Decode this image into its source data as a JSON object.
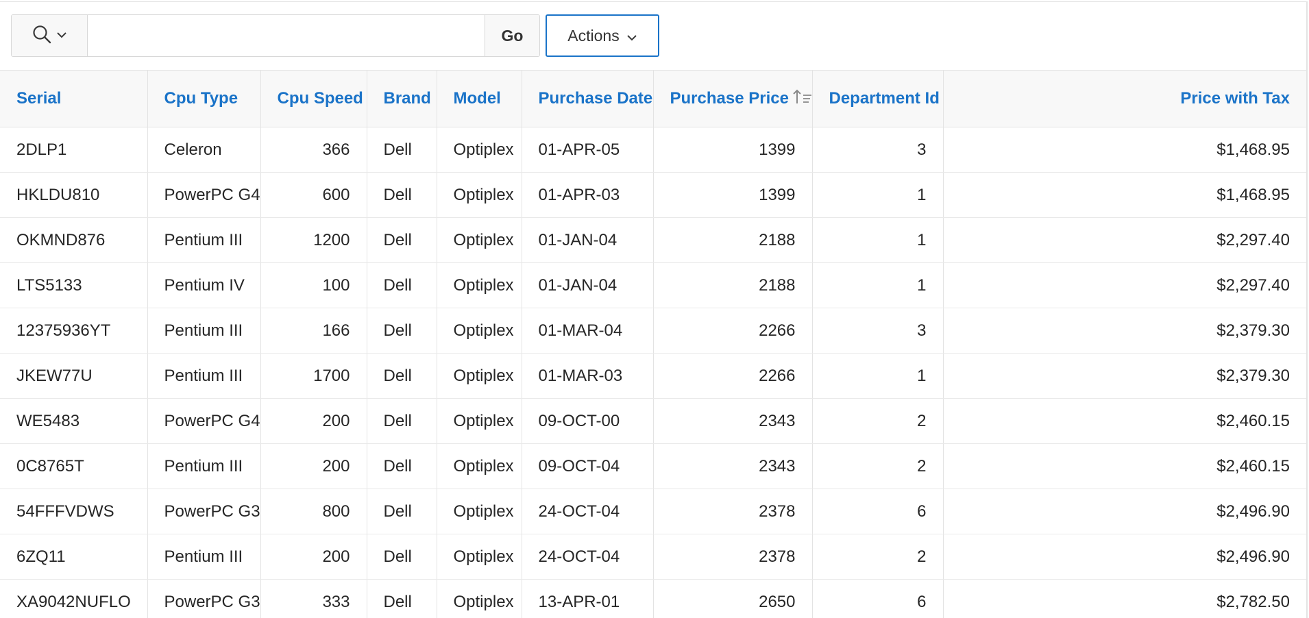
{
  "toolbar": {
    "search_value": "",
    "go_label": "Go",
    "actions_label": "Actions"
  },
  "table": {
    "columns": [
      {
        "label": "Serial",
        "align": "left"
      },
      {
        "label": "Cpu Type",
        "align": "left"
      },
      {
        "label": "Cpu Speed",
        "align": "right"
      },
      {
        "label": "Brand",
        "align": "left"
      },
      {
        "label": "Model",
        "align": "left"
      },
      {
        "label": "Purchase Date",
        "align": "left"
      },
      {
        "label": "Purchase Price",
        "align": "right",
        "sorted": "ascending"
      },
      {
        "label": "Department Id",
        "align": "right"
      },
      {
        "label": "Price with Tax",
        "align": "right"
      }
    ],
    "rows": [
      [
        "2DLP1",
        "Celeron",
        "366",
        "Dell",
        "Optiplex",
        "01-APR-05",
        "1399",
        "3",
        "$1,468.95"
      ],
      [
        "HKLDU810",
        "PowerPC G4",
        "600",
        "Dell",
        "Optiplex",
        "01-APR-03",
        "1399",
        "1",
        "$1,468.95"
      ],
      [
        "OKMND876",
        "Pentium III",
        "1200",
        "Dell",
        "Optiplex",
        "01-JAN-04",
        "2188",
        "1",
        "$2,297.40"
      ],
      [
        "LTS5133",
        "Pentium IV",
        "100",
        "Dell",
        "Optiplex",
        "01-JAN-04",
        "2188",
        "1",
        "$2,297.40"
      ],
      [
        "12375936YT",
        "Pentium III",
        "166",
        "Dell",
        "Optiplex",
        "01-MAR-04",
        "2266",
        "3",
        "$2,379.30"
      ],
      [
        "JKEW77U",
        "Pentium III",
        "1700",
        "Dell",
        "Optiplex",
        "01-MAR-03",
        "2266",
        "1",
        "$2,379.30"
      ],
      [
        "WE5483",
        "PowerPC G4",
        "200",
        "Dell",
        "Optiplex",
        "09-OCT-00",
        "2343",
        "2",
        "$2,460.15"
      ],
      [
        "0C8765T",
        "Pentium III",
        "200",
        "Dell",
        "Optiplex",
        "09-OCT-04",
        "2343",
        "2",
        "$2,460.15"
      ],
      [
        "54FFFVDWS",
        "PowerPC G3",
        "800",
        "Dell",
        "Optiplex",
        "24-OCT-04",
        "2378",
        "6",
        "$2,496.90"
      ],
      [
        "6ZQ11",
        "Pentium III",
        "200",
        "Dell",
        "Optiplex",
        "24-OCT-04",
        "2378",
        "2",
        "$2,496.90"
      ],
      [
        "XA9042NUFLO",
        "PowerPC G3",
        "333",
        "Dell",
        "Optiplex",
        "13-APR-01",
        "2650",
        "6",
        "$2,782.50"
      ]
    ]
  },
  "colors": {
    "header_link": "#1a73c8",
    "actions_border": "#1a73c8",
    "header_bg": "#f8f8f8",
    "grid_line": "#e3e3e3"
  },
  "icons": {
    "search_menu": "search-icon",
    "search_menu_caret": "chevron-down-icon",
    "actions_caret": "chevron-down-icon",
    "sort_indicator": "sort-ascending-icon"
  }
}
